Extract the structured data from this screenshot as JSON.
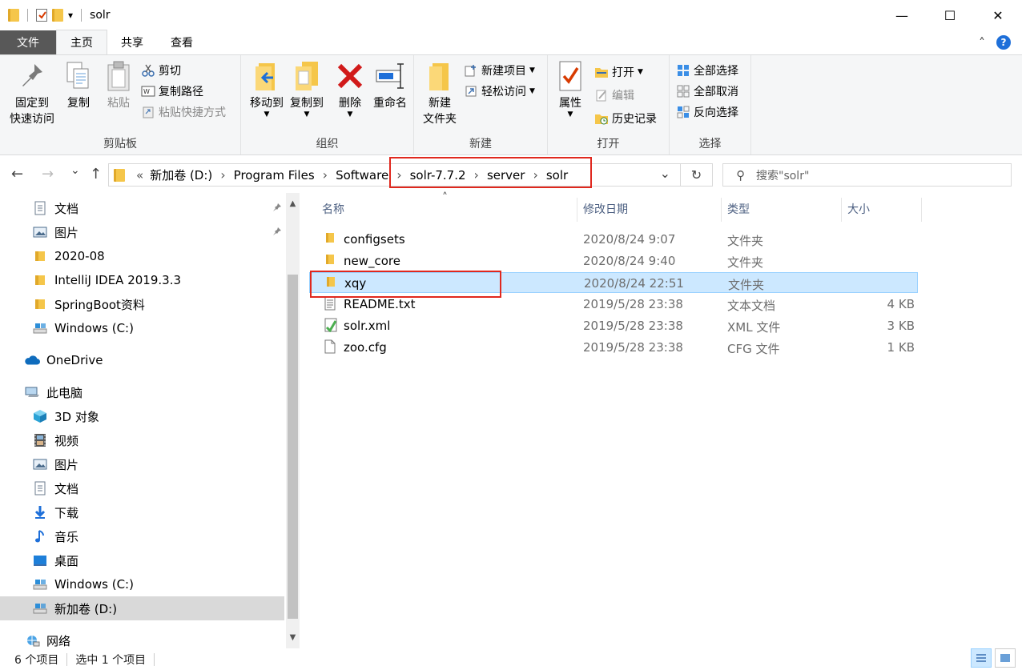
{
  "window": {
    "title": "solr",
    "minimize_glyph": "—",
    "maximize_glyph": "☐",
    "close_glyph": "✕"
  },
  "qat": {
    "dropdown_glyph": "▾"
  },
  "ribbon_tabs": {
    "file": "文件",
    "home": "主页",
    "share": "共享",
    "view": "查看",
    "collapse_glyph": "˄",
    "help_glyph": "?"
  },
  "ribbon": {
    "clipboard": {
      "label": "剪贴板",
      "pin_quick_access": "固定到\n快速访问",
      "copy": "复制",
      "paste": "粘贴",
      "cut": "剪切",
      "copy_path": "复制路径",
      "paste_shortcut": "粘贴快捷方式"
    },
    "organize": {
      "label": "组织",
      "move_to": "移动到",
      "copy_to": "复制到",
      "delete": "删除",
      "rename": "重命名"
    },
    "new": {
      "label": "新建",
      "new_folder": "新建\n文件夹",
      "new_item": "新建项目",
      "easy_access": "轻松访问"
    },
    "open": {
      "label": "打开",
      "properties": "属性",
      "open": "打开",
      "edit": "编辑",
      "history": "历史记录"
    },
    "select": {
      "label": "选择",
      "select_all": "全部选择",
      "select_none": "全部取消",
      "invert_selection": "反向选择"
    }
  },
  "nav": {
    "back_glyph": "←",
    "forward_glyph": "→",
    "recent_glyph": "⌄",
    "up_glyph": "↑",
    "overflow": "«",
    "breadcrumbs": [
      "新加卷 (D:)",
      "Program Files",
      "Software",
      "solr-7.7.2",
      "server",
      "solr"
    ],
    "chevron": "›",
    "dropdown_glyph": "⌄",
    "refresh_glyph": "↻",
    "search_placeholder": "搜索\"solr\"",
    "search_glyph": "⚲"
  },
  "sidebar": {
    "items": [
      {
        "label": "文档",
        "icon": "document-icon",
        "pinned": true
      },
      {
        "label": "图片",
        "icon": "pictures-icon",
        "pinned": true
      },
      {
        "label": "2020-08",
        "icon": "folder-icon"
      },
      {
        "label": "IntelliJ IDEA 2019.3.3",
        "icon": "folder-icon"
      },
      {
        "label": "SpringBoot资料",
        "icon": "folder-icon"
      },
      {
        "label": "Windows (C:)",
        "icon": "drive-icon"
      },
      {
        "label": "OneDrive",
        "icon": "cloud-icon"
      },
      {
        "label": "此电脑",
        "icon": "computer-icon"
      },
      {
        "label": "3D 对象",
        "icon": "cube-icon"
      },
      {
        "label": "视频",
        "icon": "video-icon"
      },
      {
        "label": "图片",
        "icon": "pictures-icon"
      },
      {
        "label": "文档",
        "icon": "document-icon"
      },
      {
        "label": "下载",
        "icon": "download-icon"
      },
      {
        "label": "音乐",
        "icon": "music-icon"
      },
      {
        "label": "桌面",
        "icon": "desktop-icon"
      },
      {
        "label": "Windows (C:)",
        "icon": "drive-icon"
      },
      {
        "label": "新加卷 (D:)",
        "icon": "drive-icon",
        "selected": true
      },
      {
        "label": "网络",
        "icon": "network-icon"
      }
    ],
    "pin_glyph": "📌",
    "scroll_up_glyph": "▲",
    "scroll_down_glyph": "▼"
  },
  "filelist": {
    "columns": {
      "name": "名称",
      "modified": "修改日期",
      "type": "类型",
      "size": "大小"
    },
    "sort_glyph": "˄",
    "rows": [
      {
        "name": "configsets",
        "modified": "2020/8/24 9:07",
        "type": "文件夹",
        "size": "",
        "icon": "folder-icon"
      },
      {
        "name": "new_core",
        "modified": "2020/8/24 9:40",
        "type": "文件夹",
        "size": "",
        "icon": "folder-icon"
      },
      {
        "name": "xqy",
        "modified": "2020/8/24 22:51",
        "type": "文件夹",
        "size": "",
        "icon": "folder-icon",
        "selected": true
      },
      {
        "name": "README.txt",
        "modified": "2019/5/28 23:38",
        "type": "文本文档",
        "size": "4 KB",
        "icon": "text-file-icon"
      },
      {
        "name": "solr.xml",
        "modified": "2019/5/28 23:38",
        "type": "XML 文件",
        "size": "3 KB",
        "icon": "xml-file-icon"
      },
      {
        "name": "zoo.cfg",
        "modified": "2019/5/28 23:38",
        "type": "CFG 文件",
        "size": "1 KB",
        "icon": "file-icon"
      }
    ]
  },
  "status": {
    "item_count": "6 个项目",
    "selected_count": "选中 1 个项目"
  }
}
